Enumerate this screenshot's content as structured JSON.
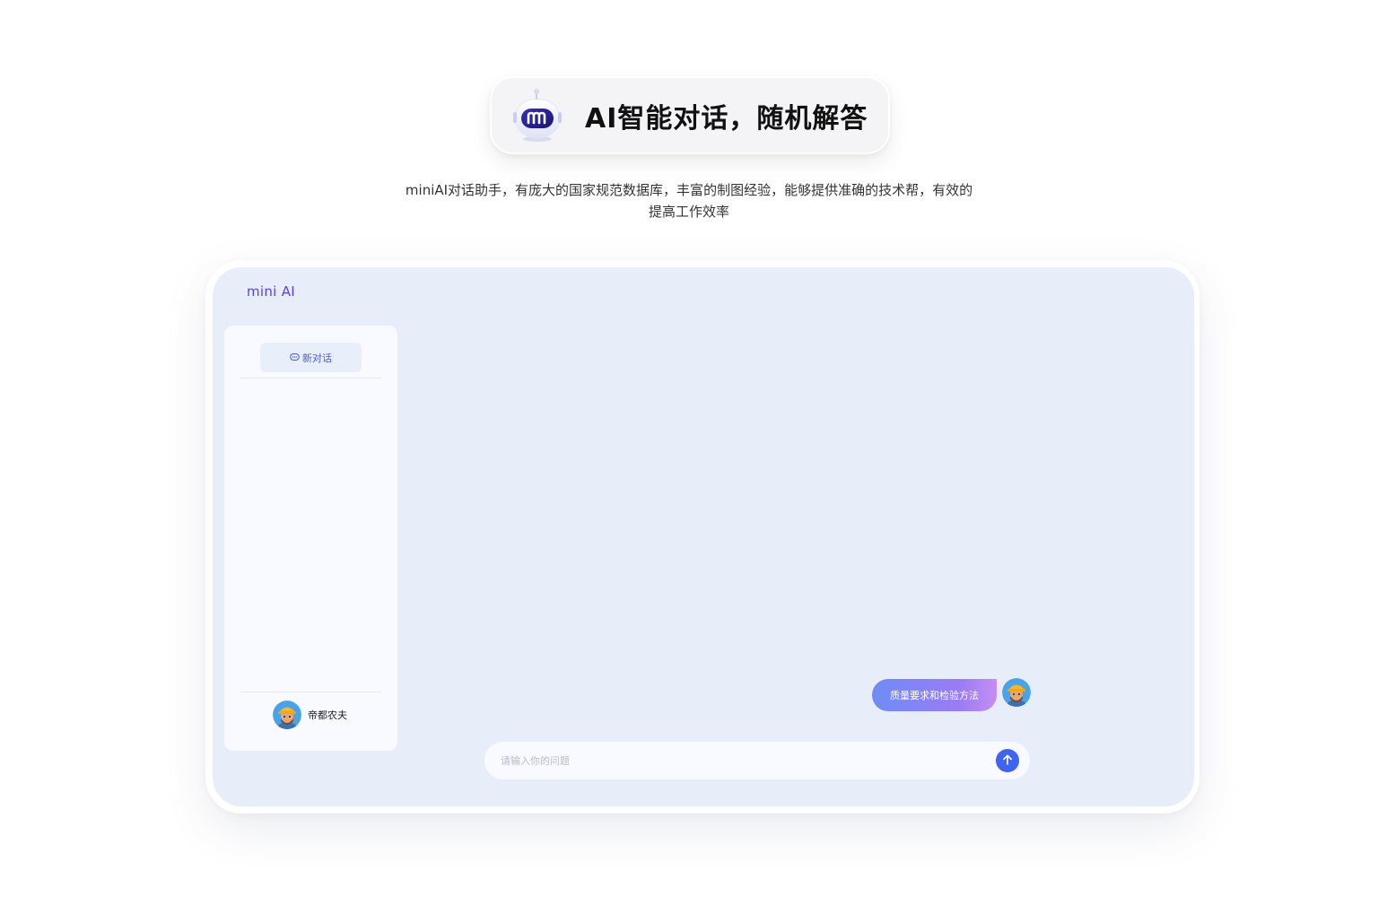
{
  "hero": {
    "title": "AI智能对话，随机解答",
    "robot_icon": "robot-mascot-icon"
  },
  "subtitle": {
    "line1": "miniAI对话助手，有庞大的国家规范数据库，丰富的制图经验，能够提供准确的技术帮，有效的",
    "line2": "提高工作效率"
  },
  "app": {
    "logo": "mini AI",
    "sidebar": {
      "new_chat_label": "新对话",
      "user_name": "帝都农夫"
    },
    "chat": {
      "messages": [
        {
          "role": "user",
          "text": "质量要求和检验方法"
        }
      ]
    },
    "input": {
      "placeholder": "请输入你的问题",
      "value": ""
    }
  },
  "colors": {
    "accent": "#3f63f2",
    "logo": "#5b3fe0",
    "app_background": "#e8eef9",
    "bubble_gradient_start": "#6f8cf7",
    "bubble_gradient_end": "#c48ef2"
  }
}
